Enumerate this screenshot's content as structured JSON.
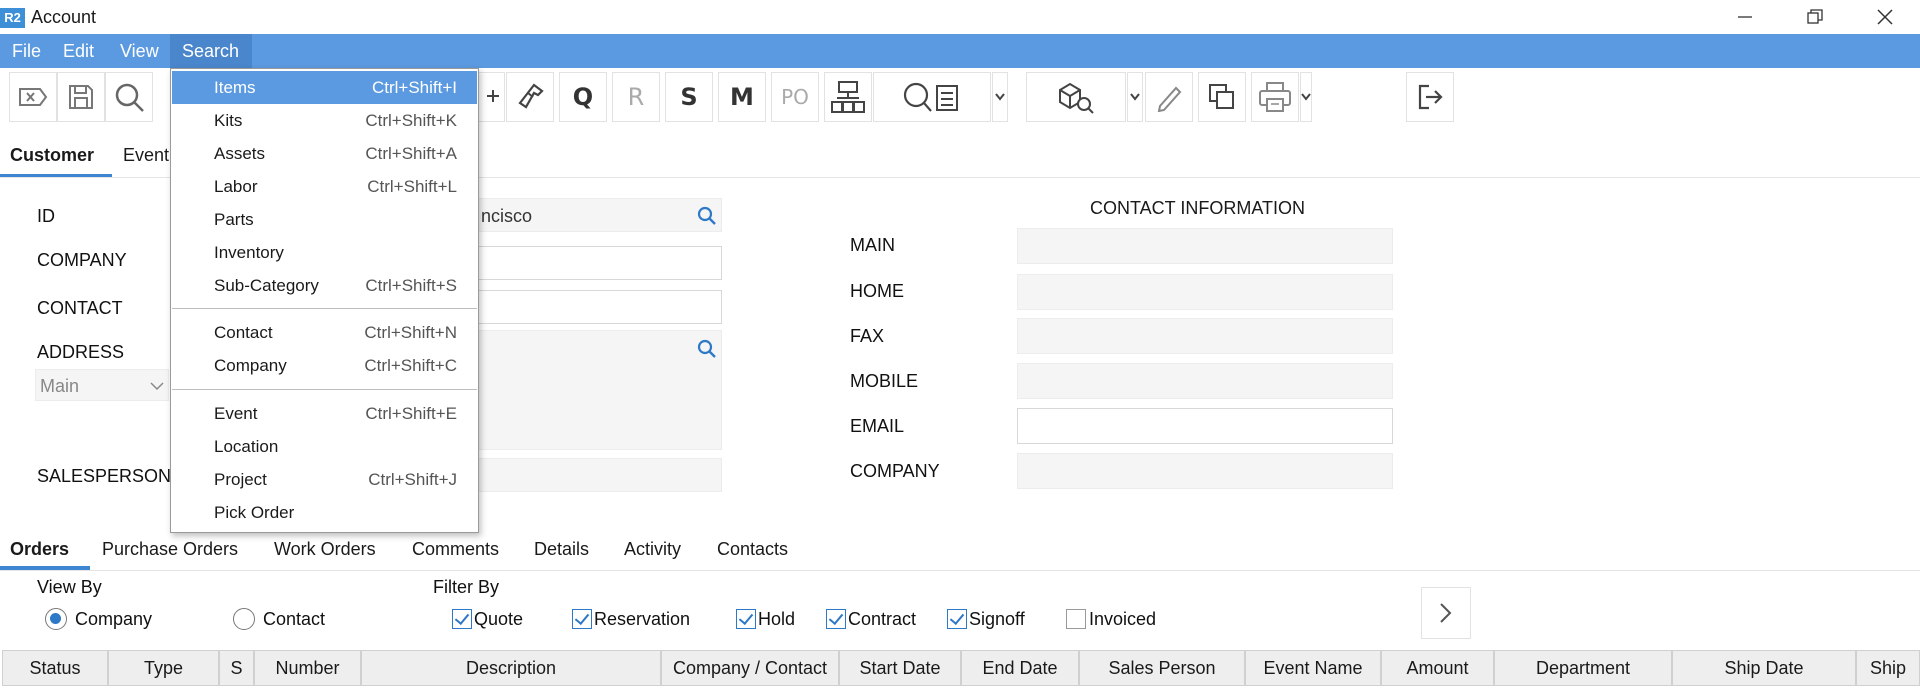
{
  "window": {
    "logo": "R2",
    "title": "Account"
  },
  "menubar": [
    "File",
    "Edit",
    "View",
    "Search"
  ],
  "toolbar": {
    "letter_buttons": [
      "Q",
      "R",
      "S",
      "M",
      "PO"
    ],
    "icons": [
      "close-doc-icon",
      "save-icon",
      "search-icon",
      "add-user-icon",
      "ticket-icon",
      "network-icon",
      "search-document-icon",
      "boxes-search-icon",
      "pencil-icon",
      "copy-icon",
      "printer-icon",
      "exit-icon"
    ]
  },
  "customer_tabs": [
    "Customer",
    "Event"
  ],
  "form": {
    "id_label": "ID",
    "company_label": "COMPANY",
    "contact_label": "CONTACT",
    "address_label": "ADDRESS",
    "address_type": "Main",
    "salesperson_label": "SALESPERSON",
    "id_value_visible": "ncisco"
  },
  "contact_info": {
    "title": "CONTACT INFORMATION",
    "labels": [
      "MAIN",
      "HOME",
      "FAX",
      "MOBILE",
      "EMAIL",
      "COMPANY"
    ]
  },
  "bottom_tabs": [
    "Orders",
    "Purchase Orders",
    "Work Orders",
    "Comments",
    "Details",
    "Activity",
    "Contacts"
  ],
  "view_by": {
    "label": "View By",
    "options": [
      "Company",
      "Contact"
    ],
    "selected": "Company"
  },
  "filter_by": {
    "label": "Filter By",
    "options": [
      {
        "label": "Quote",
        "checked": true
      },
      {
        "label": "Reservation",
        "checked": true
      },
      {
        "label": "Hold",
        "checked": true
      },
      {
        "label": "Contract",
        "checked": true
      },
      {
        "label": "Signoff",
        "checked": true
      },
      {
        "label": "Invoiced",
        "checked": false
      }
    ]
  },
  "grid_columns": [
    "Status",
    "Type",
    "S",
    "Number",
    "Description",
    "Company / Contact",
    "Start Date",
    "End Date",
    "Sales Person",
    "Event Name",
    "Amount",
    "Department",
    "Ship Date",
    "Ship"
  ],
  "search_menu": {
    "items": [
      {
        "label": "Items",
        "shortcut": "Ctrl+Shift+I"
      },
      {
        "label": "Kits",
        "shortcut": "Ctrl+Shift+K"
      },
      {
        "label": "Assets",
        "shortcut": "Ctrl+Shift+A"
      },
      {
        "label": "Labor",
        "shortcut": "Ctrl+Shift+L"
      },
      {
        "label": "Parts",
        "shortcut": ""
      },
      {
        "label": "Inventory",
        "shortcut": ""
      },
      {
        "label": "Sub-Category",
        "shortcut": "Ctrl+Shift+S"
      },
      {
        "label": "Contact",
        "shortcut": "Ctrl+Shift+N"
      },
      {
        "label": "Company",
        "shortcut": "Ctrl+Shift+C"
      },
      {
        "label": "Event",
        "shortcut": "Ctrl+Shift+E"
      },
      {
        "label": "Location",
        "shortcut": ""
      },
      {
        "label": "Project",
        "shortcut": "Ctrl+Shift+J"
      },
      {
        "label": "Pick Order",
        "shortcut": ""
      }
    ],
    "selected": "Items"
  },
  "colors": {
    "menubar": "#5b9ae0",
    "accent": "#3d86d2",
    "check": "#2e78c8"
  }
}
